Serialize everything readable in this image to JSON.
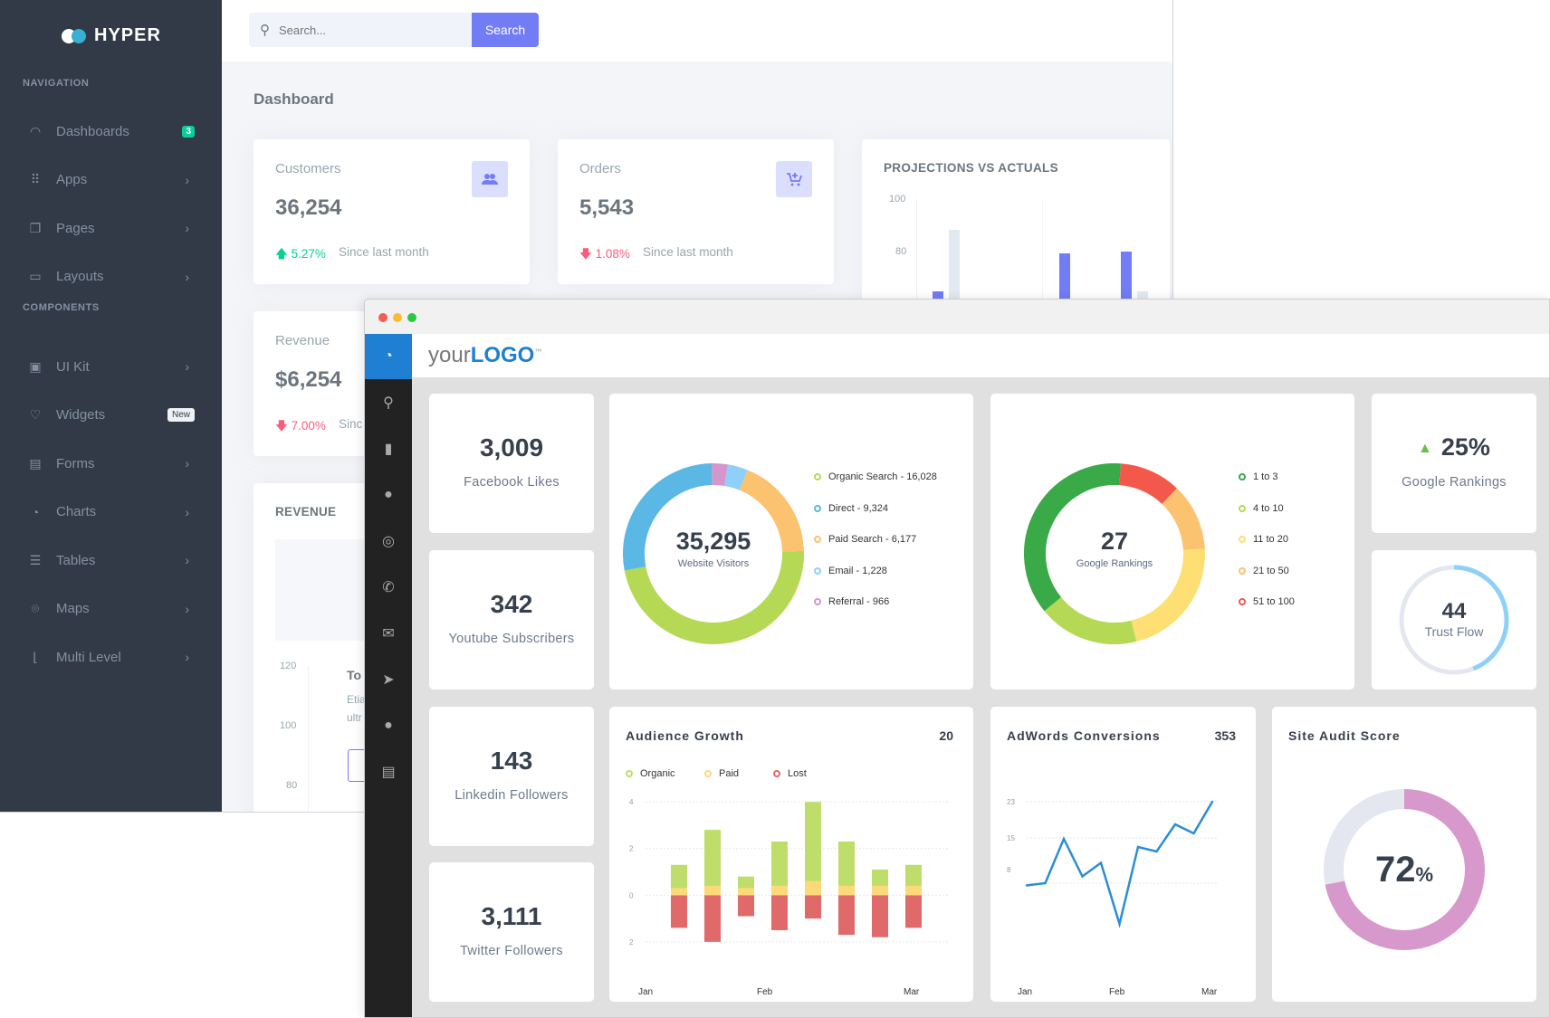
{
  "hyper": {
    "brand": "HYPER",
    "nav_section": "NAVIGATION",
    "components_section": "COMPONENTS",
    "nav_items": [
      {
        "label": "Dashboards",
        "icon": "gauge-icon",
        "badge": "3"
      },
      {
        "label": "Apps",
        "icon": "grid-icon"
      },
      {
        "label": "Pages",
        "icon": "copy-icon"
      },
      {
        "label": "Layouts",
        "icon": "window-icon"
      }
    ],
    "component_items": [
      {
        "label": "UI Kit",
        "icon": "briefcase-icon"
      },
      {
        "label": "Widgets",
        "icon": "heart-icon",
        "badge": "New"
      },
      {
        "label": "Forms",
        "icon": "document-icon"
      },
      {
        "label": "Charts",
        "icon": "pie-chart-icon"
      },
      {
        "label": "Tables",
        "icon": "list-icon"
      },
      {
        "label": "Maps",
        "icon": "map-pin-icon"
      },
      {
        "label": "Multi Level",
        "icon": "tree-icon"
      }
    ],
    "chevron": "›",
    "search": {
      "placeholder": "Search...",
      "button": "Search"
    },
    "page_title": "Dashboard",
    "cards": [
      {
        "title": "Customers",
        "value": "36,254",
        "change": "5.27%",
        "direction": "up",
        "since": "Since last month",
        "icon": "users-icon"
      },
      {
        "title": "Orders",
        "value": "5,543",
        "change": "1.08%",
        "direction": "down",
        "since": "Since last month",
        "icon": "cart-plus-icon"
      },
      {
        "title": "Revenue",
        "value": "$6,254",
        "change": "7.00%",
        "direction": "down",
        "since": "Sinc"
      }
    ],
    "projections": {
      "title": "PROJECTIONS VS ACTUALS",
      "y_ticks": [
        "100",
        "80"
      ]
    },
    "revenue": {
      "title": "REVENUE",
      "y_ticks": [
        "120",
        "100",
        "80"
      ],
      "overlay_title": "To",
      "overlay_text1": "Etia",
      "overlay_text2": "ultr"
    },
    "colors": {
      "sidebar": "#313a46",
      "primary": "#727cf5",
      "success": "#0acf97",
      "danger": "#fa5c7c"
    }
  },
  "front": {
    "logo_light": "your",
    "logo_bold": "LOGO",
    "logo_tm": "™",
    "sidebar_icons": [
      "dashboard-icon",
      "search-icon",
      "bar-chart-icon",
      "chat-icon",
      "target-icon",
      "phone-icon",
      "mail-icon",
      "send-icon",
      "user-icon",
      "clipboard-icon"
    ],
    "stats": [
      {
        "value": "3,009",
        "label": "Facebook Likes"
      },
      {
        "value": "342",
        "label": "Youtube Subscribers"
      },
      {
        "value": "143",
        "label": "Linkedin Followers"
      },
      {
        "value": "3,111",
        "label": "Twitter Followers"
      }
    ],
    "google_rank_change": {
      "value": "25%",
      "label": "Google Rankings",
      "direction": "up"
    },
    "trust_flow": {
      "value": "44",
      "label": "Trust Flow",
      "fraction": 0.44
    },
    "colors": {
      "accent": "#1e7fd3",
      "line": "#2a8dd6"
    }
  },
  "chart_data": [
    {
      "type": "pie",
      "title": "Website Visitors",
      "center_value": "35,295",
      "center_label": "Website Visitors",
      "categories": [
        "Organic Search",
        "Direct",
        "Paid Search",
        "Email",
        "Referral"
      ],
      "values": [
        16028,
        9324,
        6177,
        1228,
        966
      ],
      "legend": [
        "Organic Search - 16,028",
        "Direct - 9,324",
        "Paid Search - 6,177",
        "Email - 1,228",
        "Referral - 966"
      ],
      "colors": [
        "#b5d955",
        "#5bb7e4",
        "#fbc26f",
        "#8fd0f8",
        "#d597cb"
      ]
    },
    {
      "type": "pie",
      "title": "Google Rankings",
      "center_value": "27",
      "center_label": "Google Rankings",
      "categories": [
        "1 to 3",
        "4 to 10",
        "11 to 20",
        "21 to 50",
        "51 to 100"
      ],
      "values": [
        37,
        18,
        22,
        12,
        11
      ],
      "legend": [
        "1 to 3",
        "4 to 10",
        "11 to 20",
        "21 to 50",
        "51 to 100"
      ],
      "colors": [
        "#3aa948",
        "#b5d955",
        "#fddf73",
        "#fbc26f",
        "#f3594b"
      ]
    },
    {
      "type": "bar",
      "title": "Audience Growth",
      "headline_value": "20",
      "categories": [
        "1",
        "2",
        "3",
        "4",
        "5",
        "6",
        "7",
        "8",
        "9"
      ],
      "x_labels": [
        "Jan",
        "Feb",
        "Mar"
      ],
      "series": [
        {
          "name": "Organic",
          "values": [
            1.0,
            2.4,
            0.5,
            1.9,
            3.4,
            1.9,
            0.7,
            0.9,
            0
          ],
          "color": "#bfdd6a"
        },
        {
          "name": "Paid",
          "values": [
            0.3,
            0.4,
            0.3,
            0.4,
            0.6,
            0.4,
            0.4,
            0.4,
            0
          ],
          "color": "#fdd97a"
        },
        {
          "name": "Lost",
          "values": [
            -1.4,
            -2.0,
            -0.9,
            -1.5,
            -1.0,
            -1.7,
            -1.8,
            -1.4,
            0
          ],
          "color": "#e06a6a"
        }
      ],
      "y_ticks": [
        "4",
        "2",
        "0",
        "2"
      ],
      "ylim": [
        -2.2,
        4.2
      ]
    },
    {
      "type": "line",
      "title": "AdWords Conversions",
      "headline_value": "353",
      "x_labels": [
        "Jan",
        "Feb",
        "Mar"
      ],
      "values": [
        4.5,
        5,
        14.8,
        6.5,
        9.5,
        -4,
        13,
        12,
        18,
        16,
        23
      ],
      "y_ticks": [
        "23",
        "15",
        "8"
      ],
      "ylim": [
        -5,
        25
      ],
      "color": "#2a8dd6"
    },
    {
      "type": "pie",
      "title": "Site Audit Score",
      "center_value": "72",
      "center_unit": "%",
      "values": [
        72,
        28
      ],
      "colors": [
        "#d798cc",
        "#e4e7ef"
      ]
    }
  ]
}
